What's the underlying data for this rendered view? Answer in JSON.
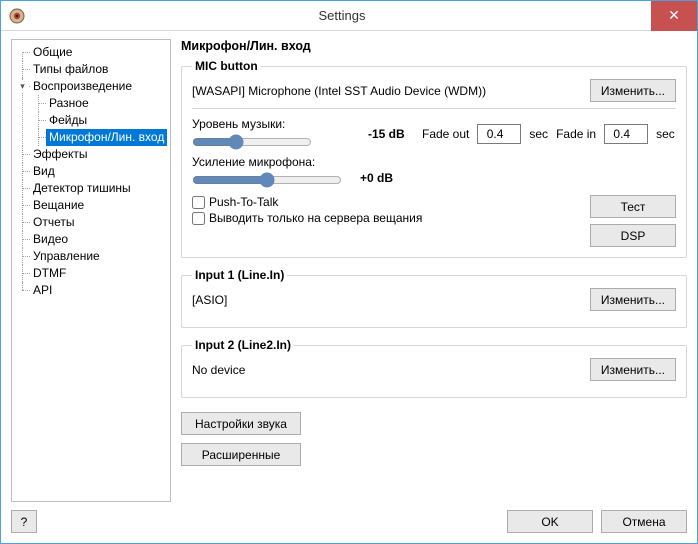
{
  "window": {
    "title": "Settings",
    "close_glyph": "✕"
  },
  "tree": {
    "items": [
      {
        "label": "Общие"
      },
      {
        "label": "Типы файлов"
      },
      {
        "label": "Воспроизведение",
        "expanded": true,
        "children": [
          {
            "label": "Разное"
          },
          {
            "label": "Фейды"
          },
          {
            "label": "Микрофон/Лин. вход",
            "selected": true
          }
        ]
      },
      {
        "label": "Эффекты"
      },
      {
        "label": "Вид"
      },
      {
        "label": "Детектор тишины"
      },
      {
        "label": "Вещание"
      },
      {
        "label": "Отчеты"
      },
      {
        "label": "Видео"
      },
      {
        "label": "Управление"
      },
      {
        "label": "DTMF"
      },
      {
        "label": "API"
      }
    ]
  },
  "content": {
    "page_title": "Микрофон/Лин. вход",
    "mic_group": {
      "legend": "MIC button",
      "device": "[WASAPI] Microphone (Intel SST Audio Device (WDM))",
      "change_btn": "Изменить...",
      "music_level_label": "Уровень музыки:",
      "music_level_value": "-15 dB",
      "music_level_slider": 35,
      "fade_out_label": "Fade out",
      "fade_out_value": "0.4",
      "fade_in_label": "Fade in",
      "fade_in_value": "0.4",
      "sec_label": "sec",
      "gain_label": "Усиление микрофона:",
      "gain_value": "+0 dB",
      "gain_slider": 50,
      "ptt_label": "Push-To-Talk",
      "to_servers_label": "Выводить только на сервера вещания",
      "test_btn": "Тест",
      "dsp_btn": "DSP"
    },
    "input1": {
      "legend": "Input 1 (Line.In)",
      "device": "[ASIO]",
      "change_btn": "Изменить..."
    },
    "input2": {
      "legend": "Input 2 (Line2.In)",
      "device": "No device",
      "change_btn": "Изменить..."
    },
    "sound_settings_btn": "Настройки звука",
    "advanced_btn": "Расширенные"
  },
  "footer": {
    "help": "?",
    "ok": "OK",
    "cancel": "Отмена"
  }
}
